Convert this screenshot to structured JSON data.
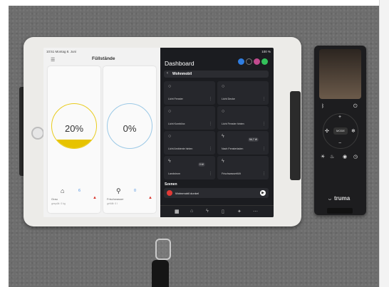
{
  "tablet": {
    "status": {
      "time": "10:51 Montag 8. Juni",
      "right": "100 %"
    },
    "left_pane": {
      "menu_icon": "hamburger-icon",
      "title": "Füllstände",
      "tanks": [
        {
          "percent": "20%",
          "fill_fraction": 0.2,
          "ring_color": "#e9cc1f",
          "fill_color": "#e7c300",
          "icon": "house-icon",
          "value": "6",
          "name": "Grau",
          "sub": "gespült: 0 kg"
        },
        {
          "percent": "0%",
          "fill_fraction": 0.0,
          "ring_color": "#9cc9e6",
          "fill_color": "#9cc9e6",
          "icon": "water-tap-icon",
          "value": "0",
          "name": "Frischwasser",
          "sub": "gefüllt: 0 l"
        }
      ]
    },
    "right_pane": {
      "title": "Dashboard",
      "header_icons": [
        {
          "icon": "plus-icon",
          "color": "#2f7de1"
        },
        {
          "icon": "tool-icon",
          "color": "#1b1c20"
        },
        {
          "icon": "profile-icon",
          "color": "#c24a8e"
        },
        {
          "icon": "status-icon",
          "color": "#33c15a"
        }
      ],
      "room": "Wohnmobil",
      "tiles": [
        {
          "label": "Licht Fenster",
          "icon": "bulb-icon",
          "badge": ""
        },
        {
          "label": "Licht Decke",
          "icon": "bulb-icon",
          "badge": ""
        },
        {
          "label": "Licht Kombi/ox",
          "icon": "bulb-icon",
          "badge": ""
        },
        {
          "label": "Licht Fenster hinten",
          "icon": "bulb-icon",
          "badge": ""
        },
        {
          "label": "Licht Ambiente hinten",
          "icon": "bulb-icon",
          "badge": ""
        },
        {
          "label": "Nach Fensterladen",
          "icon": "plug-icon",
          "badge": "56,7 W"
        },
        {
          "label": "Landstrom",
          "icon": "plug-icon",
          "badge": "0 W"
        },
        {
          "label": "Frischwasserfüllt",
          "icon": "plug-icon",
          "badge": ""
        }
      ],
      "scenes_title": "Szenen",
      "scene": {
        "label": "Wohnmobil dunkel",
        "play_icon": "play-icon"
      },
      "tabs": [
        "grid-icon",
        "home-icon",
        "lightning-icon",
        "tablet-icon",
        "sparkle-icon",
        "more-icon"
      ]
    }
  },
  "remote": {
    "brand": "truma",
    "mode_label": "MODE",
    "buttons": [
      "bluetooth-icon",
      "power-icon",
      "plus-icon",
      "minus-icon",
      "fan-icon",
      "snowflake-icon",
      "sun-icon",
      "temperature-icon"
    ]
  }
}
